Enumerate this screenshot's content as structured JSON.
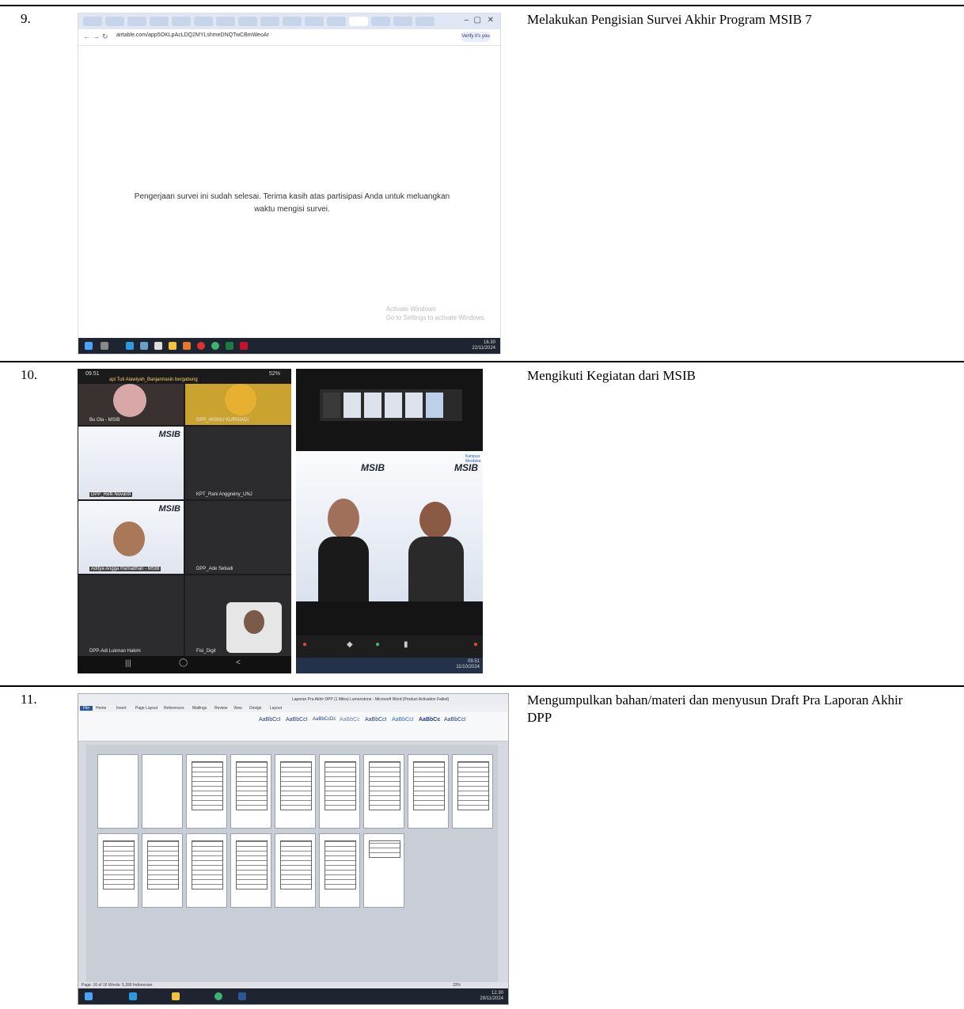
{
  "rows": [
    {
      "number": "9.",
      "description": "Melakukan Pengisian Survei Akhir Program MSIB 7",
      "screenshot": {
        "url": "airtable.com/app5OKLpAcLDQ2MYLshmeDNQTwCBmWeoAr",
        "message_line1": "Pengerjaan survei ini sudah selesai. Terima kasih atas partisipasi Anda untuk meluangkan",
        "message_line2": "waktu mengisi survei.",
        "watermark_line1": "Activate Windows",
        "watermark_line2": "Go to Settings to activate Windows.",
        "profile_label": "Verify it's you",
        "clock": "16.30",
        "date": "22/11/2024"
      }
    },
    {
      "number": "10.",
      "description": "Mengikuti Kegiatan dari MSIB",
      "phone": {
        "status_time": "09.51",
        "status_battery": "52%",
        "join_notice": "api Tuti Alawiyah_Banjarmasin bergabung",
        "tiles": [
          "Bu Ola - MSIB",
          "DPP_WISNU KURNIADI",
          "DPP_Refli Novardi",
          "KPT_Rani Anggreiny_UNJ",
          "Aditya Angga Ramadhan - MSIB",
          "DPP_Ade Setiadi",
          "DPP-Adi Lukman Hakim",
          "Fisi_Digit"
        ],
        "logo": "MSIB"
      },
      "zoom": {
        "logo": "MSIB",
        "badge": "Kampus Merdeka",
        "clock": "09.51",
        "date": "11/10/2024"
      }
    },
    {
      "number": "11.",
      "description": "Mengumpulkan bahan/materi dan menyusun Draft Pra Laporan Akhir DPP",
      "word": {
        "title": "Laporan Pra Akhir DPP (1 Mitra) Lumenstone - Microsoft Word (Product Activation Failed)",
        "tabs": [
          "File",
          "Home",
          "Insert",
          "Page Layout",
          "References",
          "Mailings",
          "Review",
          "View",
          "Design",
          "Layout"
        ],
        "styles": [
          "AaBbCcI",
          "AaBbCcI",
          "AaBbCcDc",
          "AaBbCc",
          "AaBbCcI",
          "AaBbCcI",
          "AaBbCc",
          "AaBbCcI"
        ],
        "status_left": "Page: 16 of 16   Words: 5,390   Indonesian",
        "status_right": "33%",
        "clock": "12.30",
        "date": "29/11/2024"
      }
    }
  ]
}
